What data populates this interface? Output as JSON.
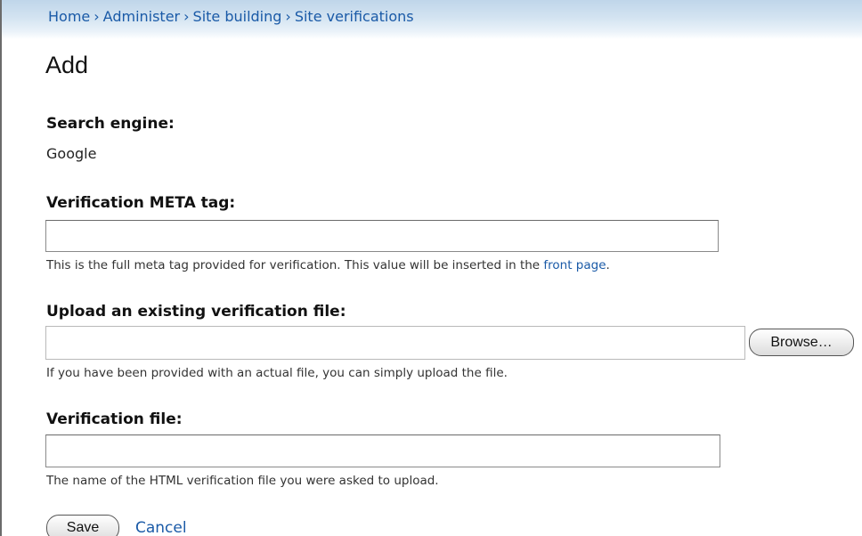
{
  "breadcrumb": {
    "items": [
      "Home",
      "Administer",
      "Site building",
      "Site verifications"
    ],
    "separator": "›"
  },
  "page": {
    "title": "Add"
  },
  "search_engine": {
    "label": "Search engine:",
    "value": "Google"
  },
  "meta_tag": {
    "label": "Verification META tag:",
    "value": "",
    "description_prefix": "This is the full meta tag provided for verification. This value will be inserted in the",
    "description_link": "front page",
    "description_suffix": "."
  },
  "upload": {
    "label": "Upload an existing verification file:",
    "browse_label": "Browse…",
    "description": "If you have been provided with an actual file, you can simply upload the file."
  },
  "verification_file": {
    "label": "Verification file:",
    "value": "",
    "description": "The name of the HTML verification file you were asked to upload."
  },
  "actions": {
    "save_label": "Save",
    "cancel_label": "Cancel"
  },
  "colors": {
    "link": "#1a5aa7",
    "header_gradient_top": "#bfd6ea"
  }
}
